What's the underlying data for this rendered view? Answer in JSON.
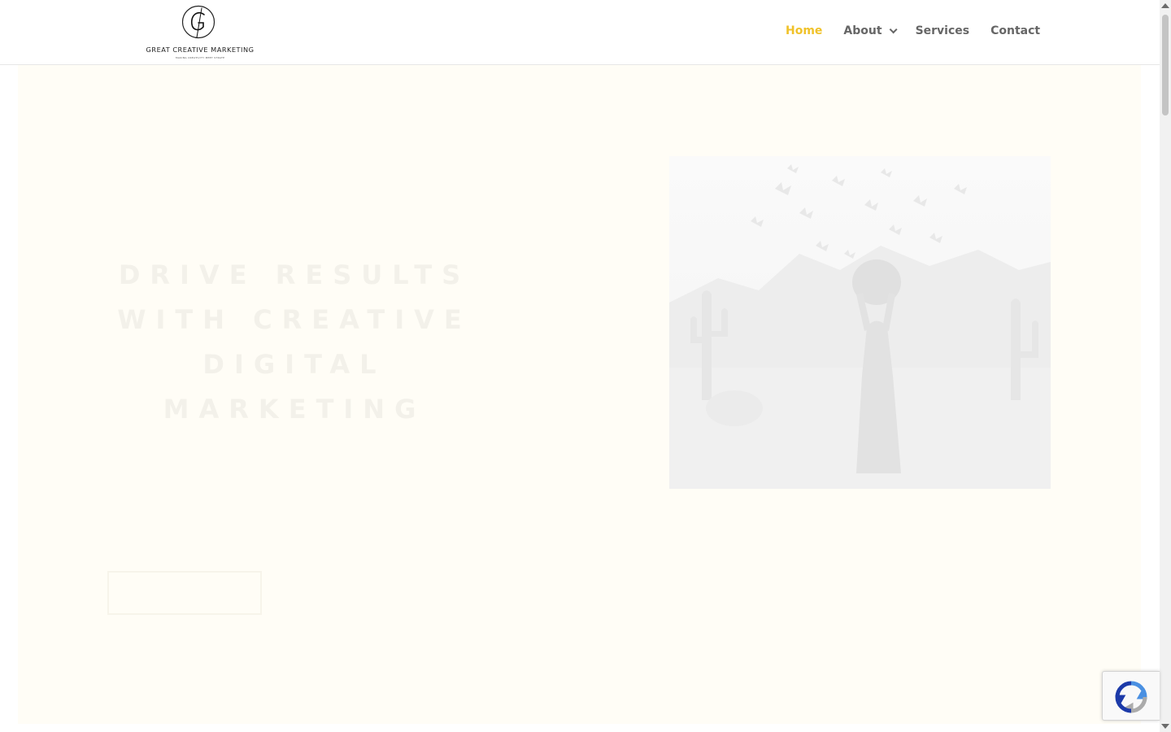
{
  "logo": {
    "initial": "G",
    "name": "GREAT CREATIVE MARKETING",
    "tagline": "MAKING CREATIVITY MEET STRATEGY"
  },
  "nav": {
    "items": [
      {
        "label": "Home",
        "active": true,
        "dropdown": false
      },
      {
        "label": "About",
        "active": false,
        "dropdown": true
      },
      {
        "label": "Services",
        "active": false,
        "dropdown": false
      },
      {
        "label": "Contact",
        "active": false,
        "dropdown": false
      }
    ]
  },
  "hero": {
    "subheading": "",
    "heading": "DRIVE RESULTS WITH CREATIVE DIGITAL MARKETING",
    "paragraph": "",
    "button_label": "",
    "image_alt": "Woman holding a hat in desert with saguaro cacti and butterflies",
    "background_color": "#fffdf6"
  },
  "colors": {
    "accent": "#f0c22a",
    "nav_text": "#666666",
    "recaptcha_blue": "#1c3aa9",
    "recaptcha_lightblue": "#4a90e2",
    "recaptcha_gray": "#ababab"
  },
  "icons": {
    "recaptcha": "recaptcha-logo-icon",
    "dropdown": "chevron-down-icon"
  }
}
